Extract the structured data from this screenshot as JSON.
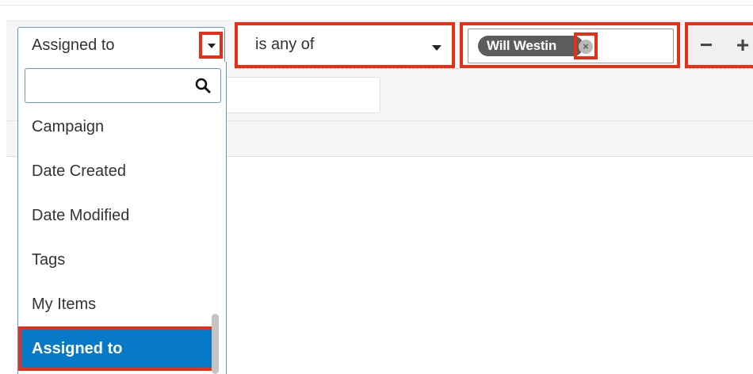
{
  "filter": {
    "field": {
      "selected": "Assigned to"
    },
    "operator": {
      "selected": "is any of"
    },
    "value": {
      "chips": [
        {
          "label": "Will Westin",
          "remove_icon": "x-circle-icon"
        }
      ]
    },
    "actions": {
      "remove_label": "−",
      "add_label": "+"
    }
  },
  "dropdown": {
    "search_placeholder": "",
    "options": [
      {
        "label": "Campaign",
        "selected": false
      },
      {
        "label": "Date Created",
        "selected": false
      },
      {
        "label": "Date Modified",
        "selected": false
      },
      {
        "label": "Tags",
        "selected": false
      },
      {
        "label": "My Items",
        "selected": false
      },
      {
        "label": "Assigned to",
        "selected": true
      }
    ]
  },
  "colors": {
    "highlight": "#e53017",
    "selected_option": "#0679c8",
    "focus_border": "#5b9bd5",
    "chip": "#5c5c5c"
  }
}
